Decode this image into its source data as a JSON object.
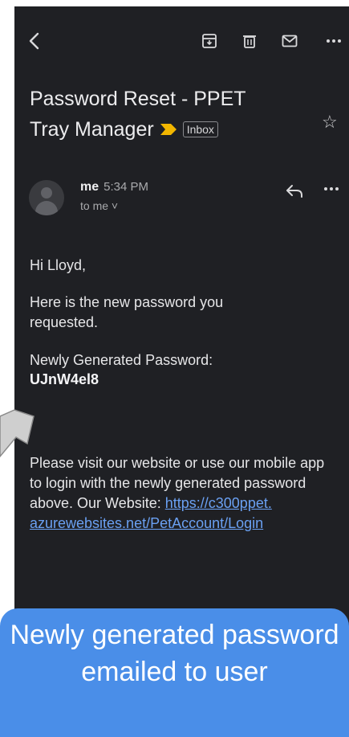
{
  "email": {
    "subject_line1": "Password Reset - PPET",
    "subject_line2": "Tray Manager",
    "label": "Inbox",
    "sender": "me",
    "time": "5:34 PM",
    "recipient": "to me ˅",
    "greeting": "Hi Lloyd,",
    "intro": "Here is the new password you requested.",
    "pw_label": "Newly Generated Password:",
    "password": "UJnW4el8",
    "instructions": "Please visit our website or use our mobile app to login with the newly generated password above. Our Website: ",
    "link_line1": "https://c300ppet.",
    "link_line2": "azurewebsites.net/PetAccount/Login"
  },
  "callout": {
    "text": "Newly generated password emailed to user"
  },
  "icons": [
    "back-icon",
    "archive-icon",
    "delete-icon",
    "mail-icon",
    "more-icon",
    "important-marker-icon",
    "star-icon",
    "avatar-icon",
    "reply-icon",
    "more-icon"
  ],
  "colors": {
    "background": "#1f2024",
    "link": "#6aa0f2",
    "callout": "#4a8ee8",
    "important": "#f2b600"
  }
}
